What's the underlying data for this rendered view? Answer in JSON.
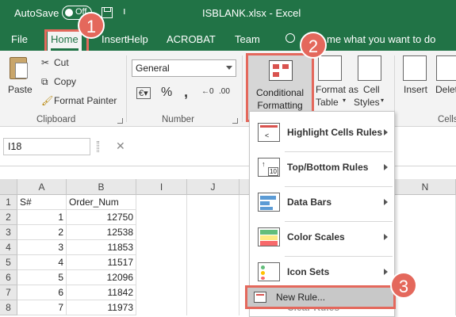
{
  "title_bar": {
    "autosave_label": "AutoSave",
    "toggle_state": "Off",
    "filename": "ISBLANK.xlsx  -  Excel"
  },
  "tabs": [
    {
      "label": "File"
    },
    {
      "label": "Home"
    },
    {
      "label": "Insert"
    },
    {
      "label": "Help"
    },
    {
      "label": "ACROBAT"
    },
    {
      "label": "Team"
    }
  ],
  "tell_me": "me what you want to do",
  "ribbon": {
    "paste": "Paste",
    "cut": "Cut",
    "copy": "Copy",
    "format_painter": "Format Painter",
    "clipboard_label": "Clipboard",
    "number_format": "General",
    "number_label": "Number",
    "cf_line1": "Conditional",
    "cf_line2": "Formatting",
    "format_table_line1": "Format as",
    "format_table_line2": "Table",
    "cell_styles_line1": "Cell",
    "cell_styles_line2": "Styles",
    "insert": "Insert",
    "delete": "Delet",
    "cells_label": "Cells",
    "accent_color": "#217346"
  },
  "formula_bar": {
    "name_box": "I18"
  },
  "grid": {
    "columns": [
      "A",
      "B",
      "I",
      "J",
      "N"
    ],
    "rows": [
      {
        "row": "1",
        "a": "S#",
        "b": "Order_Num"
      },
      {
        "row": "2",
        "a": "1",
        "b": "12750"
      },
      {
        "row": "3",
        "a": "2",
        "b": "12538"
      },
      {
        "row": "4",
        "a": "3",
        "b": "11853"
      },
      {
        "row": "5",
        "a": "4",
        "b": "11517"
      },
      {
        "row": "6",
        "a": "5",
        "b": "12096"
      },
      {
        "row": "7",
        "a": "6",
        "b": "11842"
      },
      {
        "row": "8",
        "a": "7",
        "b": "11973"
      }
    ]
  },
  "cf_menu": {
    "items": [
      {
        "label": "Highlight Cells Rules",
        "icon": "highlight-cells-icon"
      },
      {
        "label": "Top/Bottom Rules",
        "icon": "top-bottom-icon"
      },
      {
        "label": "Data Bars",
        "icon": "data-bars-icon"
      },
      {
        "label": "Color Scales",
        "icon": "color-scales-icon"
      },
      {
        "label": "Icon Sets",
        "icon": "icon-sets-icon"
      }
    ],
    "new_rule": "New Rule...",
    "clear_rules": "Clear Rules"
  },
  "callouts": [
    "1",
    "2",
    "3"
  ],
  "callout_color": "#e4685c"
}
